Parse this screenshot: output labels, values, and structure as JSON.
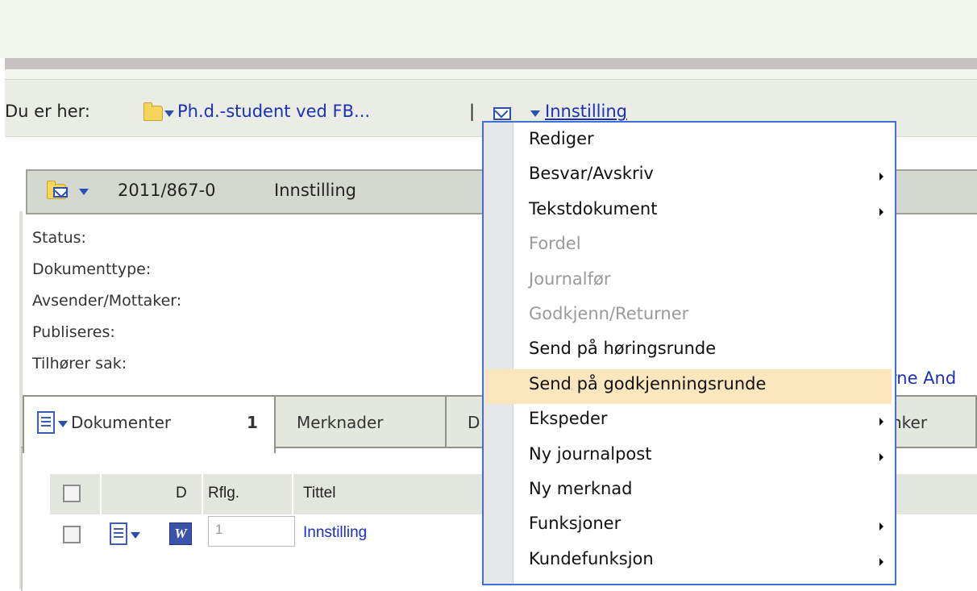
{
  "breadcrumb": {
    "prefix": "Du er her:",
    "crumb1": "Ph.d.-student ved FB...",
    "separator": "|",
    "crumb2": "Innstilling"
  },
  "document": {
    "number": "2011/867-0",
    "title": "Innstilling"
  },
  "fields": {
    "status": "Status:",
    "doctype": "Dokumenttype:",
    "sender": "Avsender/Mottaker:",
    "publish": "Publiseres:",
    "case": "Tilhører sak:",
    "case_value_partial": "rne And"
  },
  "tabs": {
    "documents": "Dokumenter",
    "documents_count": "1",
    "notes": "Merknader",
    "partial_d": "D",
    "links_partial": "nker"
  },
  "table": {
    "col_d": "D",
    "col_rflg": "Rflg.",
    "col_title": "Tittel",
    "row1_rflg": "1",
    "row1_title": "Innstilling"
  },
  "menu": {
    "items": [
      {
        "label": "Rediger",
        "disabled": false,
        "submenu": false
      },
      {
        "label": "Besvar/Avskriv",
        "disabled": false,
        "submenu": true
      },
      {
        "label": "Tekstdokument",
        "disabled": false,
        "submenu": true
      },
      {
        "label": "Fordel",
        "disabled": true,
        "submenu": false
      },
      {
        "label": "Journalfør",
        "disabled": true,
        "submenu": false
      },
      {
        "label": "Godkjenn/Returner",
        "disabled": true,
        "submenu": false
      },
      {
        "label": "Send på høringsrunde",
        "disabled": false,
        "submenu": false
      },
      {
        "label": "Send på godkjenningsrunde",
        "disabled": false,
        "submenu": false,
        "highlighted": true
      },
      {
        "label": "Ekspeder",
        "disabled": false,
        "submenu": true
      },
      {
        "label": "Ny journalpost",
        "disabled": false,
        "submenu": true
      },
      {
        "label": "Ny merknad",
        "disabled": false,
        "submenu": false
      },
      {
        "label": "Funksjoner",
        "disabled": false,
        "submenu": true
      },
      {
        "label": "Kundefunksjon",
        "disabled": false,
        "submenu": true
      }
    ]
  },
  "colors": {
    "link": "#1c2fb8",
    "menu_border": "#3f6fcf",
    "menu_highlight": "#fbe6bd",
    "disabled_text": "#9a9a9a"
  }
}
